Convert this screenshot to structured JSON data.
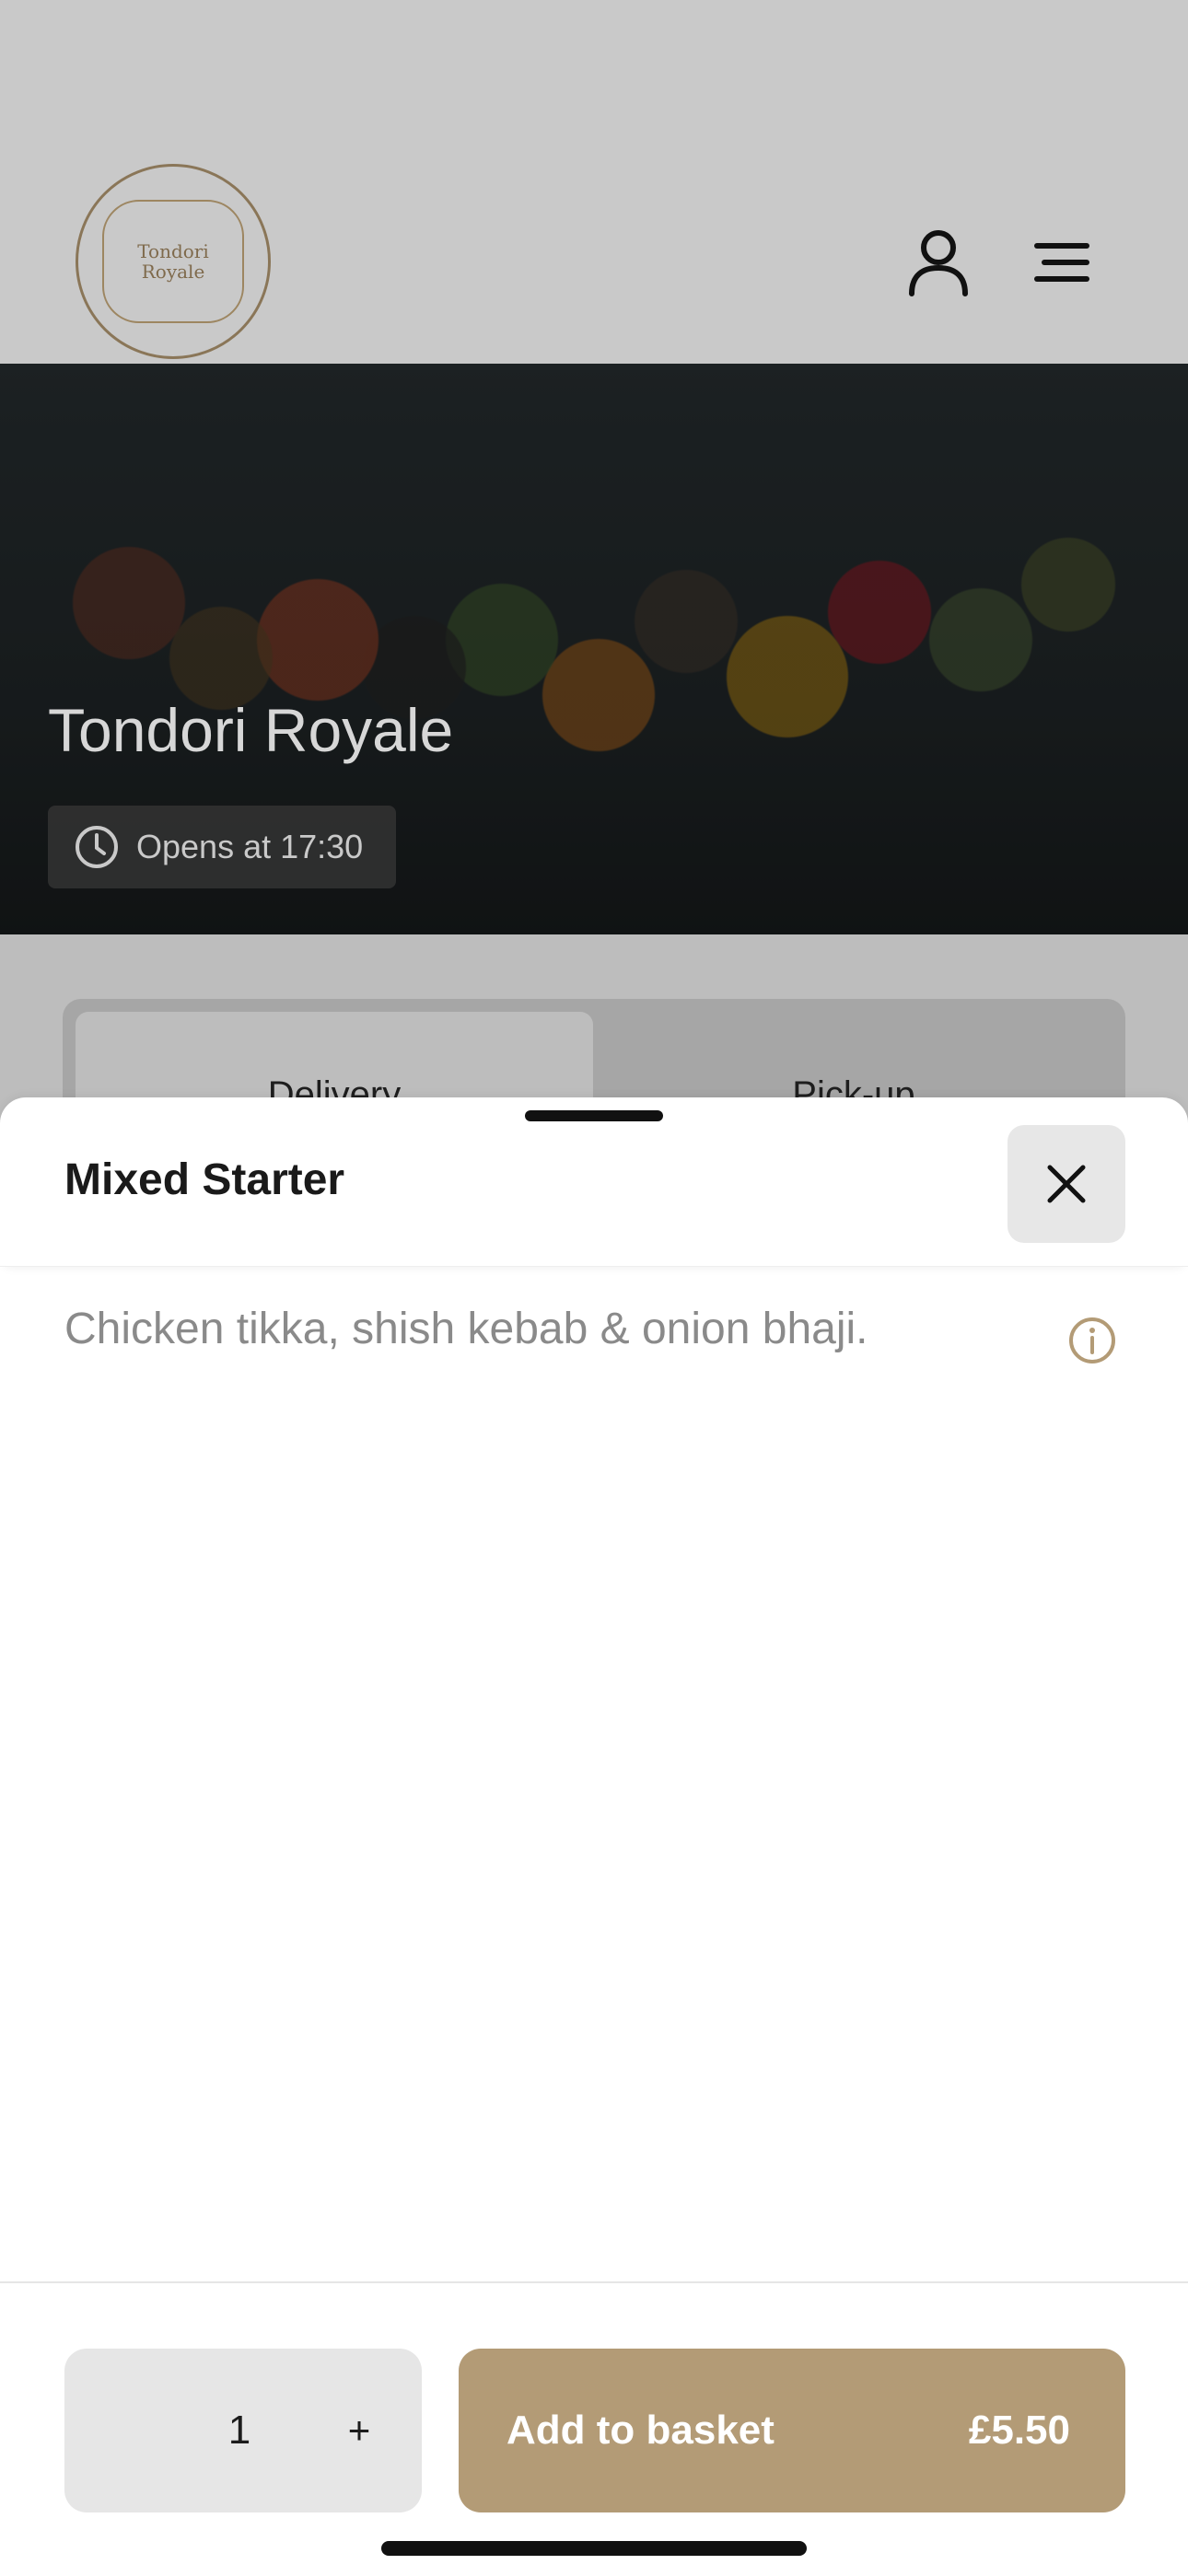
{
  "header": {
    "logo_text_line1": "Tondori",
    "logo_text_line2": "Royale",
    "account_icon": "user-icon",
    "menu_icon": "hamburger-icon"
  },
  "hero": {
    "restaurant_name": "Tondori Royale",
    "opening_status": "Opens at 17:30",
    "status_icon": "clock-icon"
  },
  "order_mode_tabs": [
    {
      "label": "Delivery",
      "selected": true
    },
    {
      "label": "Pick-up",
      "selected": false
    }
  ],
  "item_sheet": {
    "title": "Mixed Starter",
    "description": "Chicken tikka, shish kebab & onion bhaji.",
    "close_icon": "close-icon",
    "info_icon": "info-icon",
    "quantity": "1",
    "increment_label": "+",
    "add_label": "Add to basket",
    "price": "£5.50"
  },
  "colors": {
    "accent": "#b39b76",
    "overlay": "#bdbdbd"
  }
}
